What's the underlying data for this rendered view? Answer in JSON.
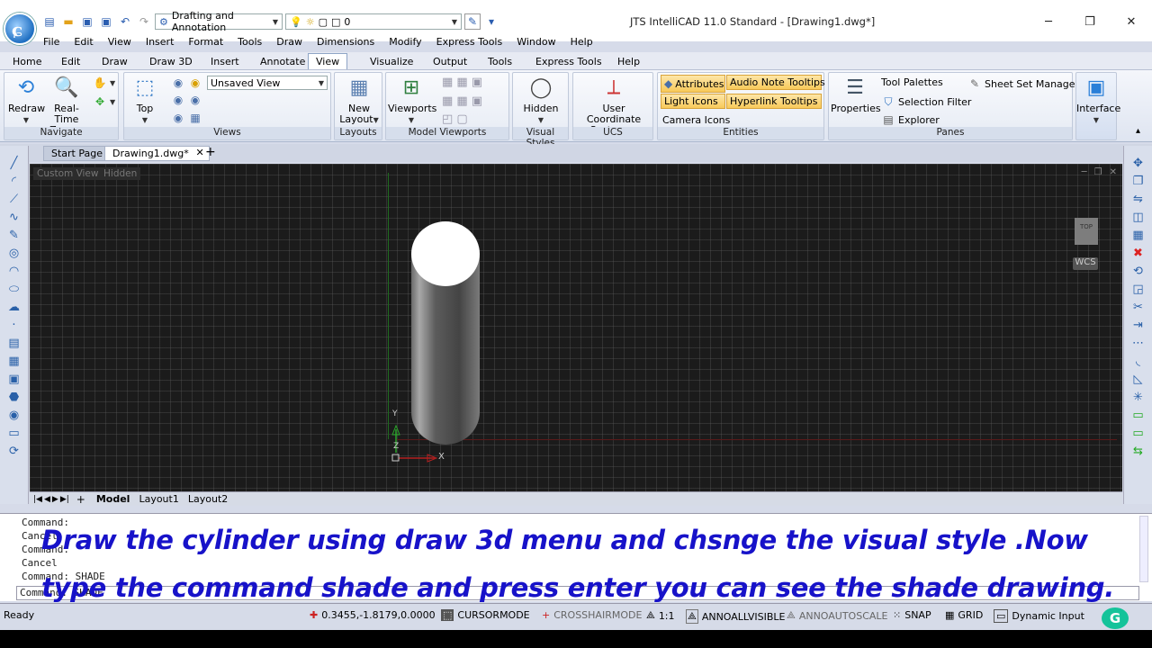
{
  "app": {
    "title": "JTS IntelliCAD 11.0 Standard - [Drawing1.dwg*]",
    "workspace": "Drafting and Annotation",
    "layer": "0"
  },
  "menubar": [
    "File",
    "Edit",
    "View",
    "Insert",
    "Format",
    "Tools",
    "Draw",
    "Dimensions",
    "Modify",
    "Express Tools",
    "Window",
    "Help"
  ],
  "ribbon_tabs": [
    "Home",
    "Edit",
    "Draw",
    "Draw 3D",
    "Insert",
    "Annotate",
    "View",
    "Visualize",
    "Output",
    "Tools",
    "Express Tools",
    "Help"
  ],
  "ribbon_active": "View",
  "ribbon": {
    "navigate": {
      "title": "Navigate",
      "redraw": "Redraw",
      "realtime": "Real-Time",
      "zoom": "Zoom"
    },
    "views": {
      "title": "Views",
      "top": "Top",
      "dropdown": "Unsaved View"
    },
    "layouts": {
      "title": "Layouts",
      "new": "New",
      "layout": "Layout"
    },
    "model_viewports": {
      "title": "Model Viewports",
      "viewports": "Viewports"
    },
    "visual_styles": {
      "title": "Visual Styles",
      "hidden": "Hidden"
    },
    "ucs": {
      "title": "UCS",
      "line1": "User Coordinate",
      "line2": "Systems"
    },
    "entities": {
      "title": "Entities",
      "attributes": "Attributes",
      "audio": "Audio Note Tooltips",
      "light": "Light Icons",
      "hyperlink": "Hyperlink Tooltips",
      "camera": "Camera Icons"
    },
    "panes": {
      "title": "Panes",
      "properties": "Properties",
      "tool_palettes": "Tool Palettes",
      "sheet_set": "Sheet Set Manager",
      "selection_filter": "Selection Filter",
      "explorer": "Explorer"
    },
    "interface": {
      "label": "Interface"
    }
  },
  "doc_tabs": {
    "start": "Start Page",
    "drawing": "Drawing1.dwg*"
  },
  "viewport": {
    "view_label": "Custom View",
    "style_label": "Hidden",
    "cube_top": "TOP",
    "wcs": "WCS",
    "axis_x": "X",
    "axis_y": "Y",
    "axis_z": "Z"
  },
  "layout_tabs": [
    "Model",
    "Layout1",
    "Layout2"
  ],
  "command": {
    "lines": [
      "Command:",
      "Cancel",
      "Command:",
      "Cancel",
      "Command: SHADE"
    ],
    "input": "Command: SHADE"
  },
  "caption": "Draw the cylinder using draw 3d menu and chsnge the visual style .Now type the command shade and press enter you can see the shade drawing.",
  "status": {
    "ready": "Ready",
    "coords": "0.3455,-1.8179,0.0000",
    "cursormode": "CURSORMODE",
    "crosshairmode": "CROSSHAIRMODE",
    "scale": "1:1",
    "annoallvisible": "ANNOALLVISIBLE",
    "annoautoscale": "ANNOAUTOSCALE",
    "snap": "SNAP",
    "grid": "GRID",
    "dynamic": "Dynamic Input"
  }
}
